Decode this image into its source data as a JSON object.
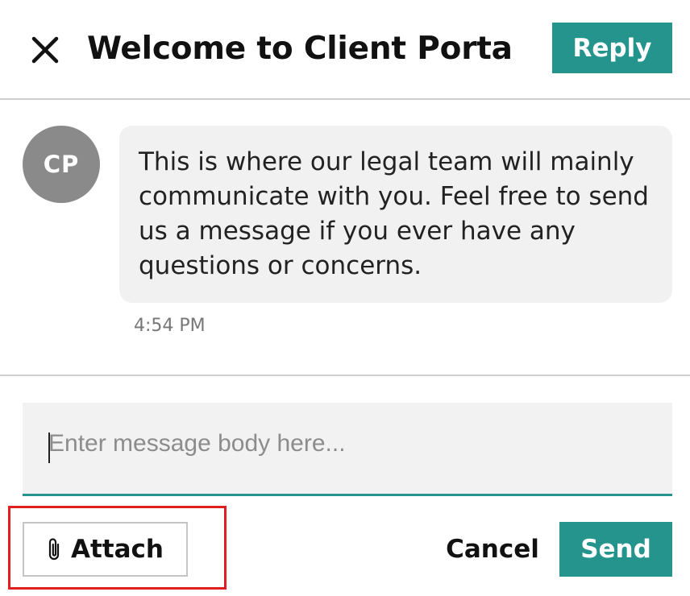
{
  "header": {
    "close_icon": "close-icon",
    "title": "Welcome to Client Portal ...",
    "reply_label": "Reply"
  },
  "message": {
    "avatar_initials": "CP",
    "body": "This is where our legal team will mainly communicate with you. Feel free to send us a message if you ever have any questions or concerns.",
    "time": "4:54 PM"
  },
  "compose": {
    "placeholder": "Enter message body here...",
    "value": ""
  },
  "actions": {
    "attach_icon": "paperclip-icon",
    "attach_label": "Attach",
    "cancel_label": "Cancel",
    "send_label": "Send"
  },
  "colors": {
    "accent": "#24948d",
    "highlight": "#e02020",
    "avatar": "#8a8a8a",
    "bubble": "#f1f1f1"
  }
}
